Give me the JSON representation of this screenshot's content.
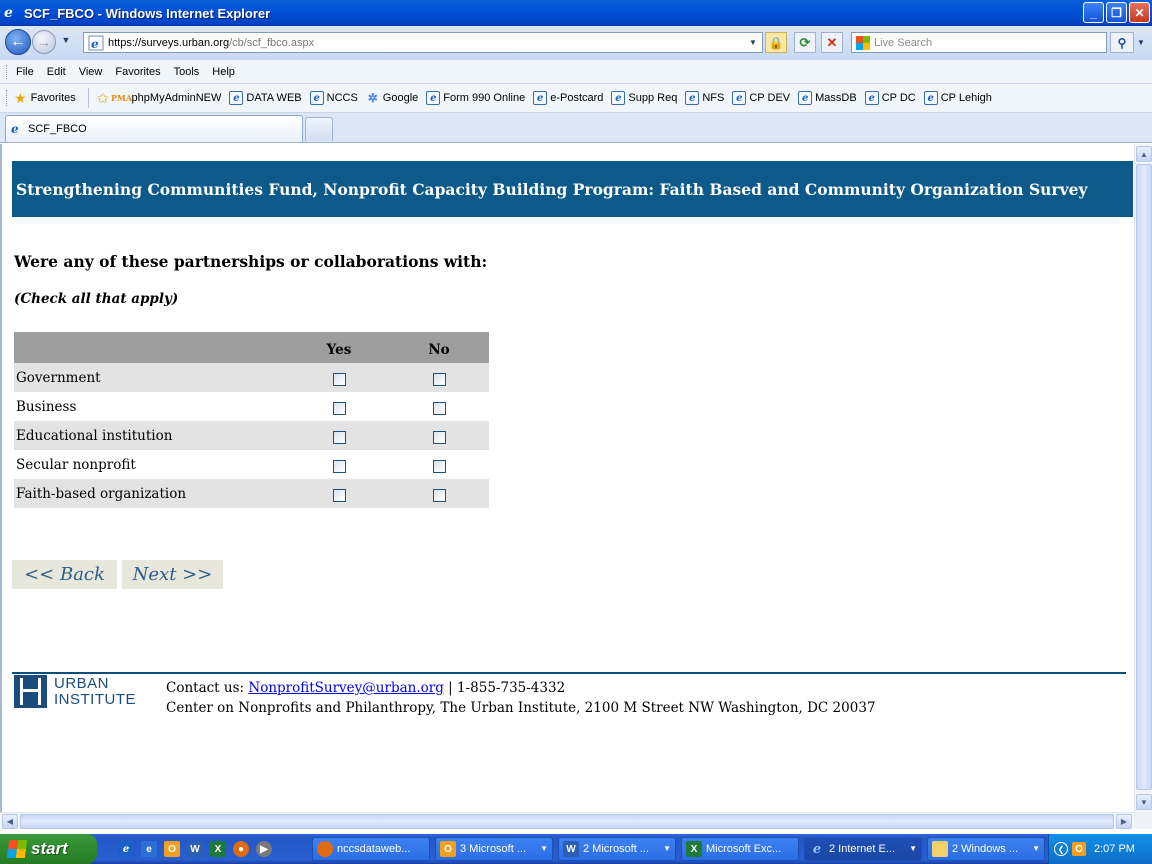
{
  "window": {
    "title": "SCF_FBCO - Windows Internet Explorer",
    "app_icon": "ie-icon",
    "controls": {
      "minimize": "_",
      "maximize": "❐",
      "close": "✕"
    }
  },
  "address_bar": {
    "url_prefix": "https://surveys.",
    "url_host": "urban.org",
    "url_path": "/cb/scf_fbco.aspx",
    "search_placeholder": "Live Search"
  },
  "menu": {
    "items": [
      "File",
      "Edit",
      "View",
      "Favorites",
      "Tools",
      "Help"
    ]
  },
  "favorites_bar": {
    "favorites_label": "Favorites",
    "links": [
      {
        "label": "phpMyAdminNEW",
        "icon": "phpmyadmin-icon"
      },
      {
        "label": "DATA WEB",
        "icon": "ie-page-icon"
      },
      {
        "label": "NCCS",
        "icon": "ie-page-icon"
      },
      {
        "label": "Google",
        "icon": "google-icon"
      },
      {
        "label": "Form 990 Online",
        "icon": "ie-page-icon"
      },
      {
        "label": "e-Postcard",
        "icon": "ie-page-icon"
      },
      {
        "label": "Supp Req",
        "icon": "ie-page-icon"
      },
      {
        "label": "NFS",
        "icon": "ie-page-icon"
      },
      {
        "label": "CP DEV",
        "icon": "ie-page-icon"
      },
      {
        "label": "MassDB",
        "icon": "ie-page-icon"
      },
      {
        "label": "CP DC",
        "icon": "ie-page-icon"
      },
      {
        "label": "CP Lehigh",
        "icon": "ie-page-icon"
      }
    ]
  },
  "tabs": [
    {
      "label": "SCF_FBCO",
      "active": true
    }
  ],
  "page": {
    "banner_title": "Strengthening Communities Fund, Nonprofit Capacity Building Program: Faith Based and Community Organization Survey",
    "question": "Were any of these partnerships or collaborations with:",
    "instruction": "(Check all that apply)",
    "grid": {
      "columns": [
        "Yes",
        "No"
      ],
      "rows": [
        {
          "label": "Government",
          "yes": false,
          "no": false
        },
        {
          "label": "Business",
          "yes": false,
          "no": false
        },
        {
          "label": "Educational institution",
          "yes": false,
          "no": false
        },
        {
          "label": "Secular nonprofit",
          "yes": false,
          "no": false
        },
        {
          "label": "Faith-based organization",
          "yes": false,
          "no": false
        }
      ]
    },
    "back_label": "<< Back",
    "next_label": "Next >>",
    "footer": {
      "logo_line1": "URBAN",
      "logo_line2": "INSTITUTE",
      "contact_prefix": "Contact us: ",
      "email": "NonprofitSurvey@urban.org",
      "phone_sep": " | ",
      "phone": "1-855-735-4332",
      "address": "Center on Nonprofits and Philanthropy, The Urban Institute, 2100 M Street NW Washington, DC 20037"
    }
  },
  "taskbar": {
    "start_label": "start",
    "tasks": [
      {
        "label": "nccsdataweb...",
        "icon": "firefox-icon"
      },
      {
        "label": "3 Microsoft ...",
        "icon": "outlook-icon"
      },
      {
        "label": "2 Microsoft ...",
        "icon": "word-icon"
      },
      {
        "label": "Microsoft Exc...",
        "icon": "excel-icon"
      },
      {
        "label": "2 Internet E...",
        "icon": "ie-icon",
        "active": true
      },
      {
        "label": "2 Windows ...",
        "icon": "folder-icon"
      }
    ],
    "clock": "2:07 PM"
  },
  "colors": {
    "banner_bg": "#0d5a8a",
    "grid_header_bg": "#9e9e9e",
    "grid_row_alt_bg": "#e3e3e3",
    "nav_button_bg": "#e8e7dc",
    "nav_button_text": "#2c5d8a",
    "footer_rule": "#0d4f7a"
  }
}
